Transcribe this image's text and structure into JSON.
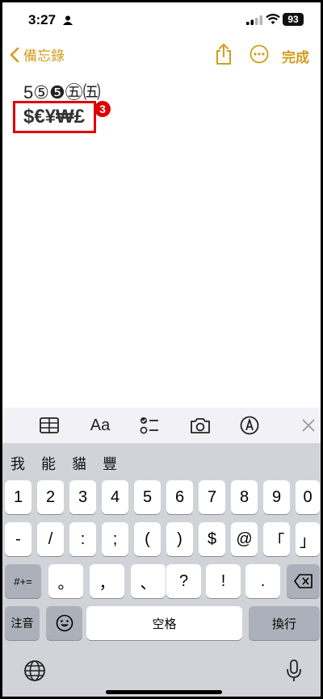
{
  "status_bar": {
    "time": "3:27",
    "battery": "93"
  },
  "nav": {
    "back_label": "備忘錄",
    "done_label": "完成"
  },
  "note": {
    "line1": "5⑤❺㊄㈤",
    "line2": "$€¥₩£"
  },
  "annotation": {
    "badge": "3"
  },
  "toolbar": {
    "format_label": "Aa"
  },
  "keyboard": {
    "candidates": [
      "我",
      "能",
      "貓",
      "豐"
    ],
    "row1": [
      "1",
      "2",
      "3",
      "4",
      "5",
      "6",
      "7",
      "8",
      "9",
      "0"
    ],
    "row2": [
      "-",
      "/",
      ":",
      ";",
      "(",
      ")",
      "$",
      "@",
      "「",
      "」"
    ],
    "row3_left": "#+=",
    "row3": [
      "。",
      "，",
      "、",
      "?",
      "!",
      "."
    ],
    "bottom": {
      "zhuyin": "注音",
      "space": "空格",
      "return": "換行"
    }
  }
}
